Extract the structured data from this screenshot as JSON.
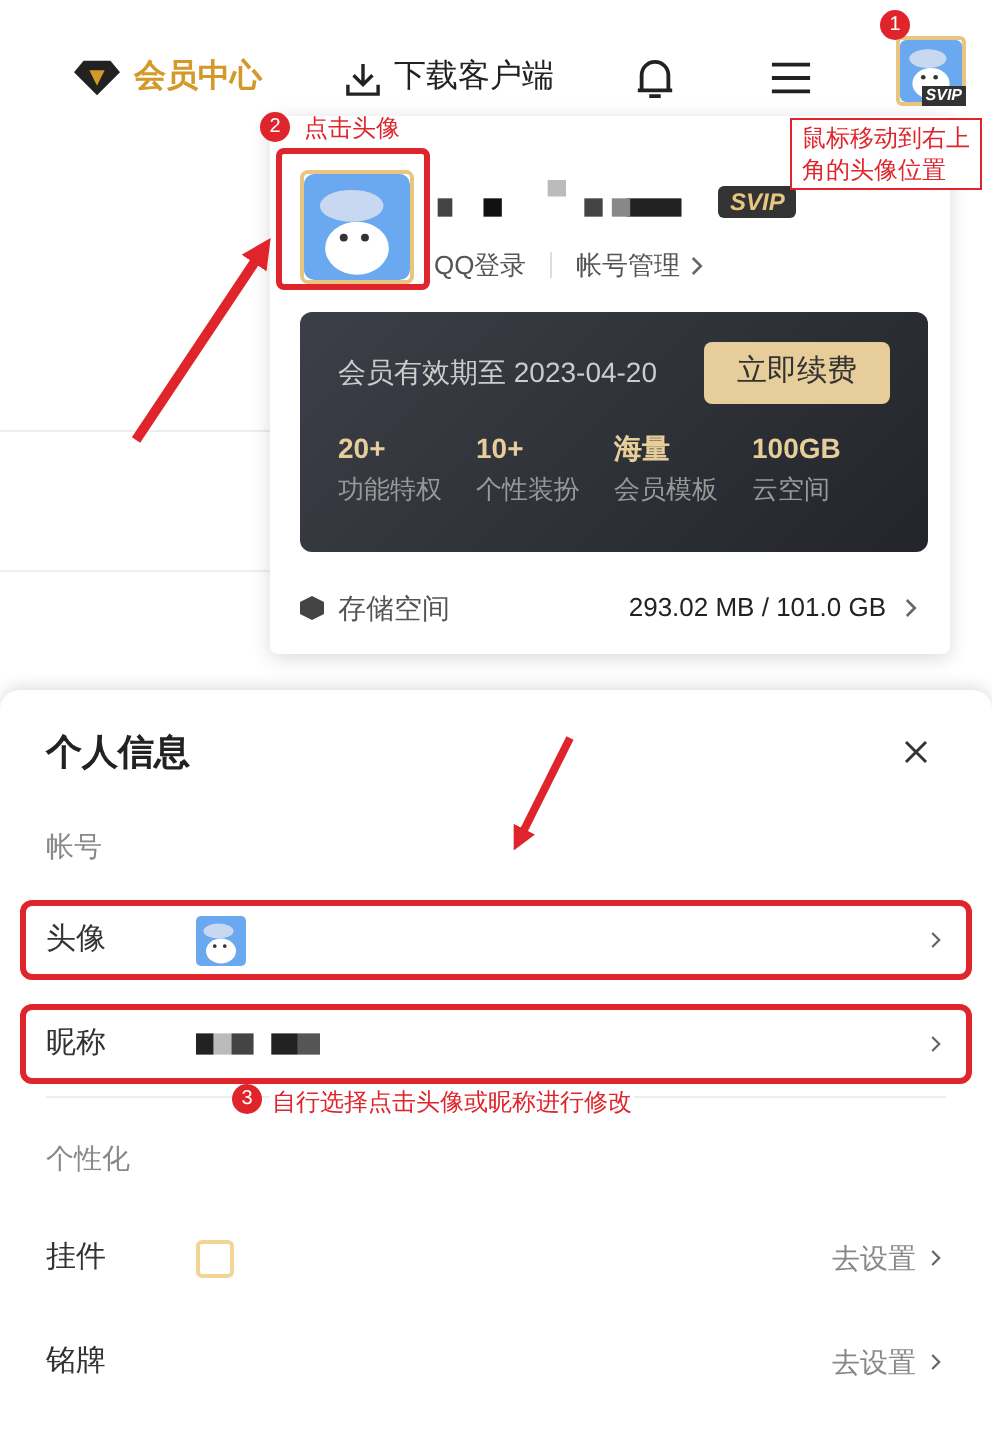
{
  "header": {
    "vip_center": "会员中心",
    "download": "下载客户端",
    "avatar_badge": "SVIP"
  },
  "profile_menu": {
    "badge": "SVIP",
    "login_type": "QQ登录",
    "account_manage": "帐号管理",
    "membership": {
      "expiry": "会员有效期至 2023-04-20",
      "renew_button": "立即续费",
      "perks": [
        {
          "value": "20+",
          "label": "功能特权"
        },
        {
          "value": "10+",
          "label": "个性装扮"
        },
        {
          "value": "海量",
          "label": "会员模板"
        },
        {
          "value": "100GB",
          "label": "云空间"
        }
      ]
    },
    "storage": {
      "label": "存储空间",
      "value": "293.02 MB / 101.0 GB"
    }
  },
  "sheet": {
    "title": "个人信息",
    "sections": [
      {
        "heading": "帐号",
        "rows": [
          {
            "kind": "avatar",
            "label": "头像",
            "highlighted": true
          },
          {
            "kind": "nickname",
            "label": "昵称",
            "highlighted": true
          }
        ]
      },
      {
        "heading": "个性化",
        "rows": [
          {
            "kind": "pendant",
            "label": "挂件",
            "action": "去设置",
            "highlighted": false
          },
          {
            "kind": "nameplate",
            "label": "铭牌",
            "action": "去设置",
            "highlighted": false
          }
        ]
      }
    ]
  },
  "annotations": [
    {
      "number": "1",
      "text": "鼠标移动到右上角的头像位置"
    },
    {
      "number": "2",
      "text": "点击头像"
    },
    {
      "number": "3",
      "text": "自行选择点击头像或昵称进行修改"
    }
  ]
}
